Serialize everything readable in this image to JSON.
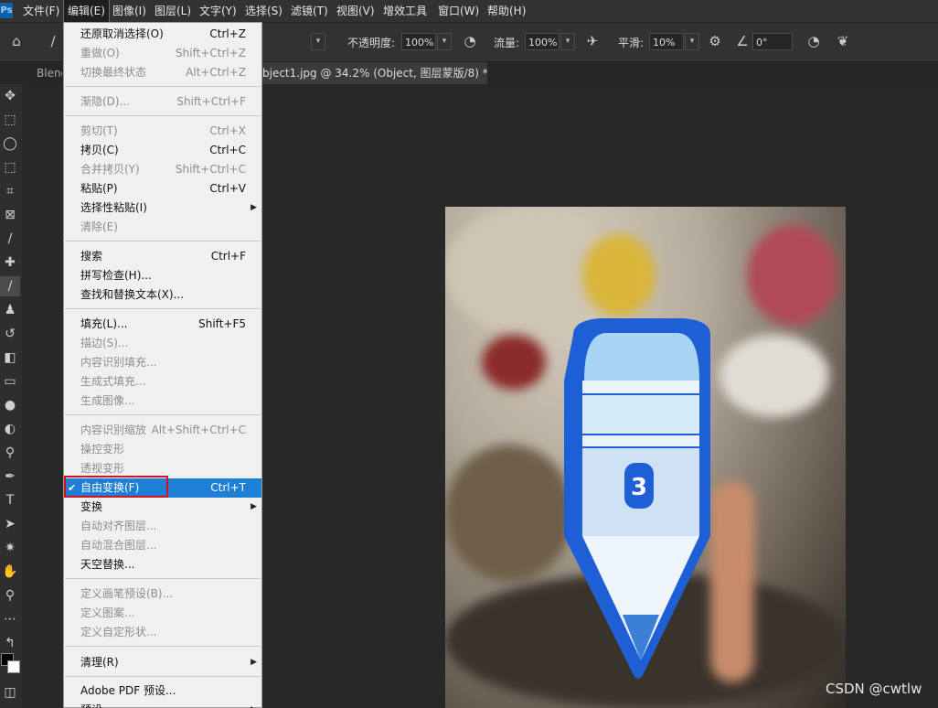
{
  "app": {
    "logo": "Ps"
  },
  "menubar": {
    "items": [
      {
        "label": "文件(F)"
      },
      {
        "label": "编辑(E)"
      },
      {
        "label": "图像(I)"
      },
      {
        "label": "图层(L)"
      },
      {
        "label": "文字(Y)"
      },
      {
        "label": "选择(S)"
      },
      {
        "label": "滤镜(T)"
      },
      {
        "label": "视图(V)"
      },
      {
        "label": "增效工具"
      },
      {
        "label": "窗口(W)"
      },
      {
        "label": "帮助(H)"
      }
    ]
  },
  "options": {
    "opacity_label": "不透明度:",
    "opacity_value": "100%",
    "flow_label": "流量:",
    "flow_value": "100%",
    "smooth_label": "平滑:",
    "smooth_value": "10%",
    "angle_value": "0°"
  },
  "tabs": {
    "first": "Blend",
    "active": "bject1.jpg @ 34.2% (Object, 图层蒙版/8) *",
    "close_glyph": "×"
  },
  "edit_menu": {
    "items": [
      {
        "label": "还原取消选择(O)",
        "shortcut": "Ctrl+Z"
      },
      {
        "label": "重做(O)",
        "shortcut": "Shift+Ctrl+Z"
      },
      {
        "label": "切换最终状态",
        "shortcut": "Alt+Ctrl+Z"
      },
      {
        "label": "渐隐(D)...",
        "shortcut": "Shift+Ctrl+F"
      },
      {
        "label": "剪切(T)",
        "shortcut": "Ctrl+X"
      },
      {
        "label": "拷贝(C)",
        "shortcut": "Ctrl+C"
      },
      {
        "label": "合并拷贝(Y)",
        "shortcut": "Shift+Ctrl+C"
      },
      {
        "label": "粘贴(P)",
        "shortcut": "Ctrl+V"
      },
      {
        "label": "选择性粘贴(I)",
        "shortcut": ""
      },
      {
        "label": "清除(E)",
        "shortcut": ""
      },
      {
        "label": "搜索",
        "shortcut": "Ctrl+F"
      },
      {
        "label": "拼写检查(H)...",
        "shortcut": ""
      },
      {
        "label": "查找和替换文本(X)...",
        "shortcut": ""
      },
      {
        "label": "填充(L)...",
        "shortcut": "Shift+F5"
      },
      {
        "label": "描边(S)...",
        "shortcut": ""
      },
      {
        "label": "内容识别填充...",
        "shortcut": ""
      },
      {
        "label": "生成式填充...",
        "shortcut": ""
      },
      {
        "label": "生成图像...",
        "shortcut": ""
      },
      {
        "label": "内容识别缩放",
        "shortcut": "Alt+Shift+Ctrl+C"
      },
      {
        "label": "操控变形",
        "shortcut": ""
      },
      {
        "label": "透视变形",
        "shortcut": ""
      },
      {
        "label": "自由变换(F)",
        "shortcut": "Ctrl+T"
      },
      {
        "label": "变换",
        "shortcut": ""
      },
      {
        "label": "自动对齐图层...",
        "shortcut": ""
      },
      {
        "label": "自动混合图层...",
        "shortcut": ""
      },
      {
        "label": "天空替换...",
        "shortcut": ""
      },
      {
        "label": "定义画笔预设(B)...",
        "shortcut": ""
      },
      {
        "label": "定义图案...",
        "shortcut": ""
      },
      {
        "label": "定义自定形状...",
        "shortcut": ""
      },
      {
        "label": "清理(R)",
        "shortcut": ""
      },
      {
        "label": "Adobe PDF 预设...",
        "shortcut": ""
      },
      {
        "label": "预设",
        "shortcut": ""
      }
    ],
    "check_glyph": "✔",
    "submenu_glyph": "▶"
  },
  "canvas": {
    "pencil_number": "3",
    "watermark": "CSDN @cwtlw"
  },
  "colors": {
    "accent": "#1e7fd6",
    "highlight_border": "#d4111e",
    "pencil_blue": "#1f5fd6"
  }
}
